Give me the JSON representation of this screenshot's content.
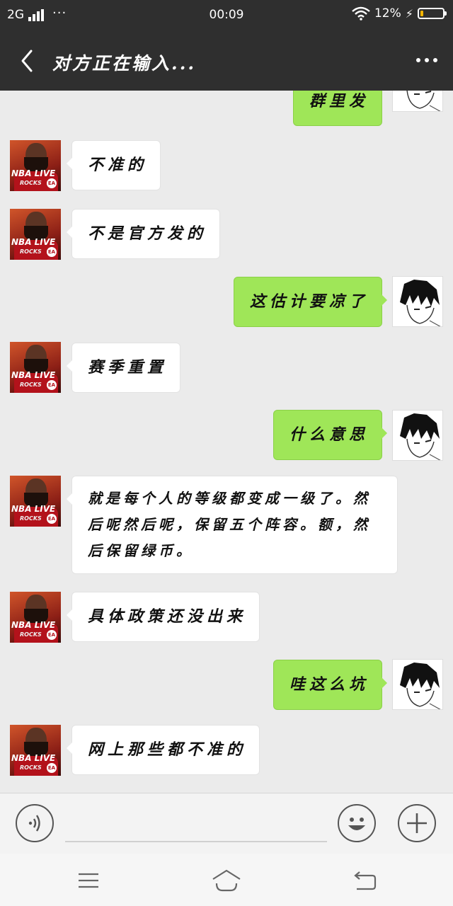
{
  "status_bar": {
    "network": "2G",
    "time": "00:09",
    "battery_percent": "12%",
    "battery_level": 0.12,
    "battery_color": "#f4b400",
    "icons": [
      "signal-icon",
      "wifi-icon",
      "charging-icon",
      "battery-icon"
    ]
  },
  "header": {
    "title": "对方正在输入...",
    "back_icon": "back-arrow-icon",
    "more_icon": "more-dots-icon"
  },
  "colors": {
    "outgoing_bubble": "#9fe658",
    "incoming_bubble": "#ffffff",
    "chat_background": "#ebebeb",
    "header_background": "#2f2f2f"
  },
  "messages": [
    {
      "side": "out",
      "text": "群里发"
    },
    {
      "side": "in",
      "text": "不准的"
    },
    {
      "side": "in",
      "text": "不是官方发的"
    },
    {
      "side": "out",
      "text": "这估计要凉了"
    },
    {
      "side": "in",
      "text": "赛季重置"
    },
    {
      "side": "out",
      "text": "什么意思"
    },
    {
      "side": "in",
      "text": "就是每个人的等级都变成一级了。然后呢然后呢，保留五个阵容。额，然后保留绿币。"
    },
    {
      "side": "in",
      "text": "具体政策还没出来"
    },
    {
      "side": "out",
      "text": "哇这么坑"
    },
    {
      "side": "in",
      "text": "网上那些都不准的"
    }
  ],
  "avatars": {
    "incoming": {
      "name": "nba-live-avatar",
      "text": "NBA LIVE",
      "sub": "ROCKS",
      "badge": "EA"
    },
    "outgoing": {
      "name": "anime-avatar"
    }
  },
  "input_bar": {
    "icons": [
      "voice-icon",
      "emoji-icon",
      "plus-icon"
    ]
  },
  "nav_bar": {
    "icons": [
      "menu-icon",
      "home-icon",
      "back-icon"
    ]
  }
}
